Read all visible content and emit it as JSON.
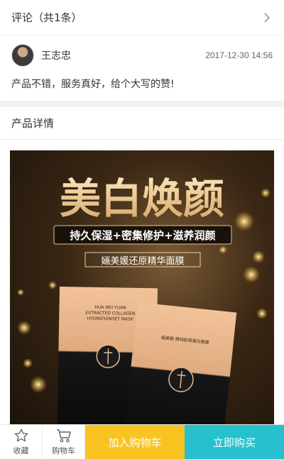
{
  "reviews": {
    "title": "评论（共1条）",
    "item": {
      "username": "王志忠",
      "time": "2017-12-30 14:56",
      "text": "产品不错，服务真好，给个大写的赞!"
    }
  },
  "details": {
    "title": "产品详情",
    "image": {
      "headline": "美白焕颜",
      "tagline": "持久保湿+密集修护+滋养润颜",
      "product_name": "婳美媛还原精华面膜",
      "pack_en_1": "HUA MEI YUAN",
      "pack_en_2": "EXTRACTED COLLAGEN",
      "pack_en_3": "HYDRATIONSET MASK",
      "pack_cn": "婳美媛 精纯胶原蛋白面膜"
    }
  },
  "bottom_bar": {
    "favorite_label": "收藏",
    "cart_icon_label": "购物车",
    "add_to_cart": "加入购物车",
    "buy_now": "立即购买",
    "colors": {
      "cart": "#f9c322",
      "buy": "#26c1cd"
    }
  }
}
